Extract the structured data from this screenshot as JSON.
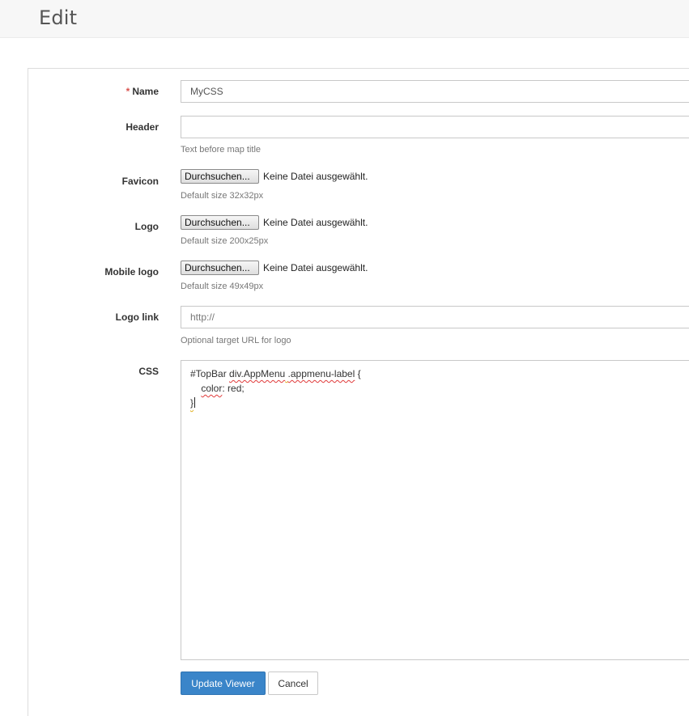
{
  "header": {
    "title": "Edit"
  },
  "form": {
    "name": {
      "label": "Name",
      "required_mark": "*",
      "value": "MyCSS"
    },
    "header_field": {
      "label": "Header",
      "value": "",
      "help": "Text before map title"
    },
    "favicon": {
      "label": "Favicon",
      "button": "Durchsuchen...",
      "status": "Keine Datei ausgewählt.",
      "help": "Default size 32x32px"
    },
    "logo": {
      "label": "Logo",
      "button": "Durchsuchen...",
      "status": "Keine Datei ausgewählt.",
      "help": "Default size 200x25px"
    },
    "mobile_logo": {
      "label": "Mobile logo",
      "button": "Durchsuchen...",
      "status": "Keine Datei ausgewählt.",
      "help": "Default size 49x49px"
    },
    "logo_link": {
      "label": "Logo link",
      "placeholder": "http://",
      "help": "Optional target URL for logo"
    },
    "css": {
      "label": "CSS",
      "line1": {
        "selector_id": "#TopBar ",
        "selector_div": "div.AppMenu",
        "gap": " ",
        "selector_class": ".appmenu-label",
        "brace_open": " {"
      },
      "line2": {
        "indent": "    ",
        "property": "color",
        "rest": ": red;"
      },
      "line3": {
        "brace_close": "}"
      }
    }
  },
  "actions": {
    "submit": "Update Viewer",
    "cancel": "Cancel"
  },
  "colors": {
    "primary": "#3a85c9",
    "required": "#d9534f",
    "spellcheck": "#e03a3a"
  }
}
